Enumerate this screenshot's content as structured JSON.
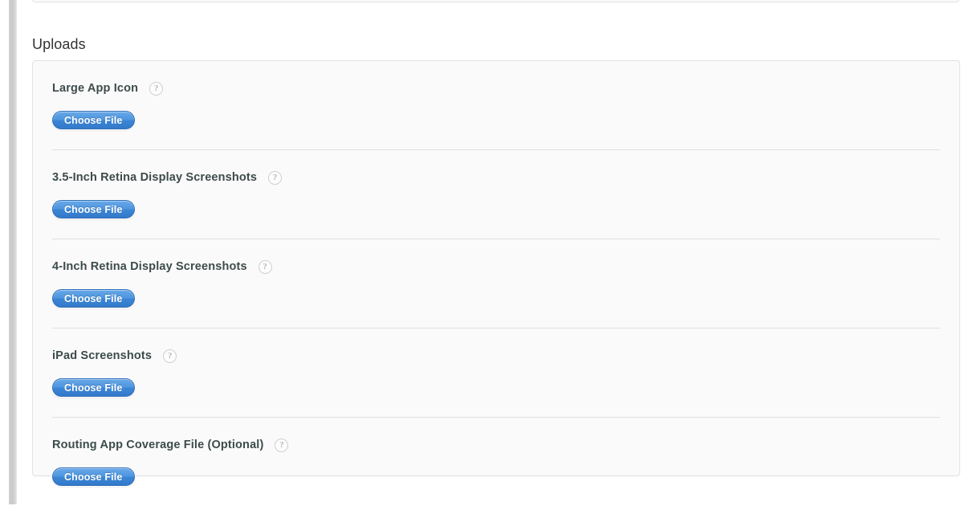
{
  "section": {
    "title": "Uploads"
  },
  "help_icon_glyph": "?",
  "colors": {
    "accent_button_top": "#68a8e8",
    "accent_button_bottom": "#3379c9",
    "button_border": "#2f6fb8",
    "label_text": "#3d4b4b",
    "title_text": "#333333",
    "card_background": "#fafafa",
    "card_border": "#e3e3e3",
    "divider": "#e0e0e0",
    "help_icon_border": "#cfcfcf",
    "help_icon_text": "#b6b6b6",
    "page_background": "#ffffff",
    "left_rail": "#c9c9c9"
  },
  "uploads": {
    "rows": [
      {
        "label": "Large App Icon",
        "help": "?",
        "button_label": "Choose File"
      },
      {
        "label": "3.5-Inch Retina Display Screenshots",
        "help": "?",
        "button_label": "Choose File"
      },
      {
        "label": "4-Inch Retina Display Screenshots",
        "help": "?",
        "button_label": "Choose File"
      },
      {
        "label": "iPad Screenshots",
        "help": "?",
        "button_label": "Choose File"
      },
      {
        "label": "Routing App Coverage File (Optional)",
        "help": "?",
        "button_label": "Choose File"
      }
    ]
  }
}
